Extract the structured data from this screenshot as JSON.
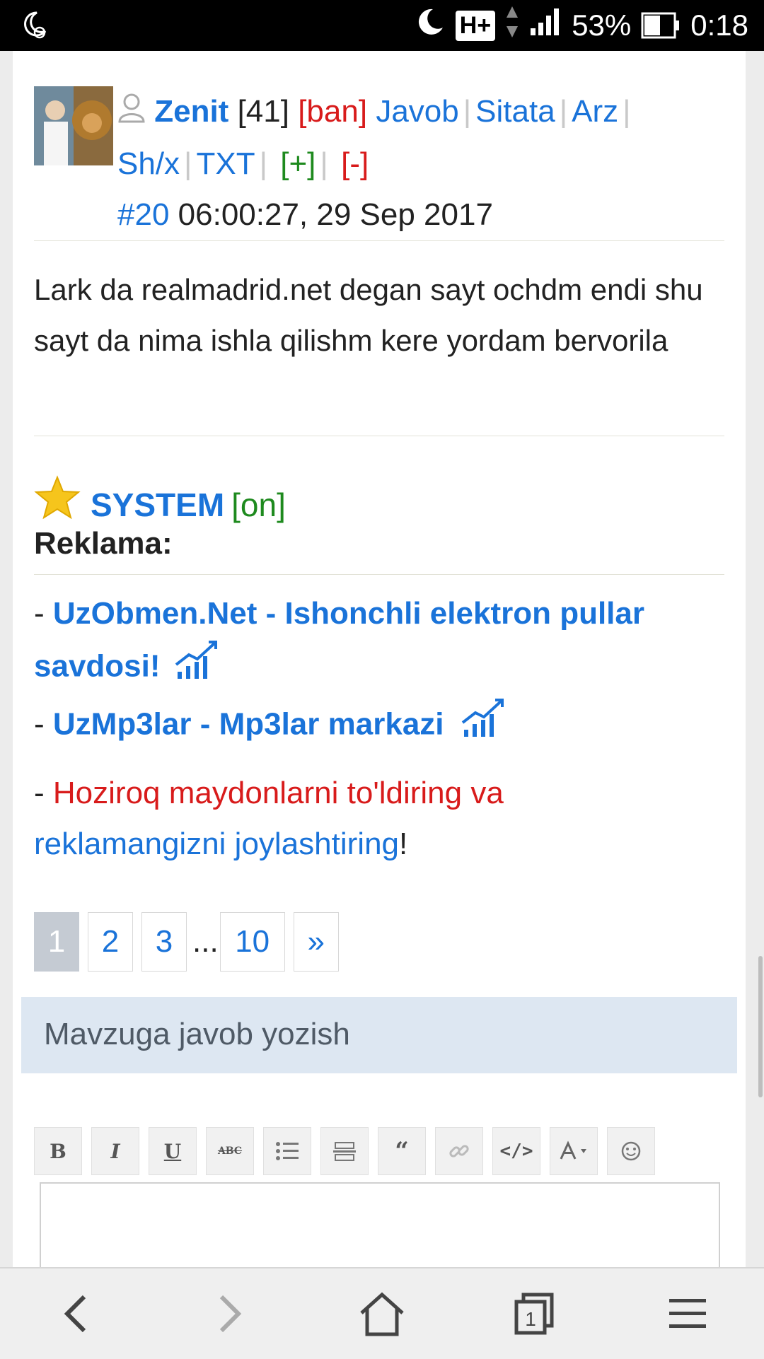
{
  "status": {
    "network": "H+",
    "battery": "53%",
    "time": "0:18"
  },
  "post": {
    "username": "Zenit",
    "count": "[41]",
    "ban": "[ban]",
    "actions": [
      "Javob",
      "Sitata",
      "Arz",
      "Sh/x",
      "TXT"
    ],
    "plus": "[+]",
    "minus": "[-]",
    "post_number": "#20",
    "timestamp": "06:00:27, 29 Sep 2017",
    "body": "Lark da realmadrid.net degan sayt ochdm endi shu sayt da nima ishla qilishm kere yordam bervorila"
  },
  "system": {
    "name": "SYSTEM",
    "status": "[on]",
    "reklama_title": "Reklama:",
    "ads": [
      {
        "prefix": "- ",
        "text": "UzObmen.Net - Ishonchli elektron pullar savdosi!"
      },
      {
        "prefix": "- ",
        "text": "UzMp3lar - Mp3lar markazi"
      }
    ],
    "cta_prefix": "- ",
    "cta_red": "Hoziroq maydonlarni to'ldiring va",
    "cta_blue": "reklamangizni joylashtiring",
    "cta_suffix": "!"
  },
  "pager": {
    "pages": [
      "1",
      "2",
      "3"
    ],
    "dots": "...",
    "last": "10",
    "next": "»",
    "active": "1"
  },
  "reply": {
    "title": "Mavzuga javob yozish"
  },
  "editor": {
    "buttons": [
      "bold",
      "italic",
      "underline",
      "strike",
      "list",
      "hr",
      "quote",
      "link",
      "code",
      "color",
      "smiley"
    ]
  },
  "colors": {
    "link_blue": "#1a73d9",
    "red": "#d81b1b",
    "green": "#1e8a1e",
    "reply_bar": "#dde7f2"
  }
}
